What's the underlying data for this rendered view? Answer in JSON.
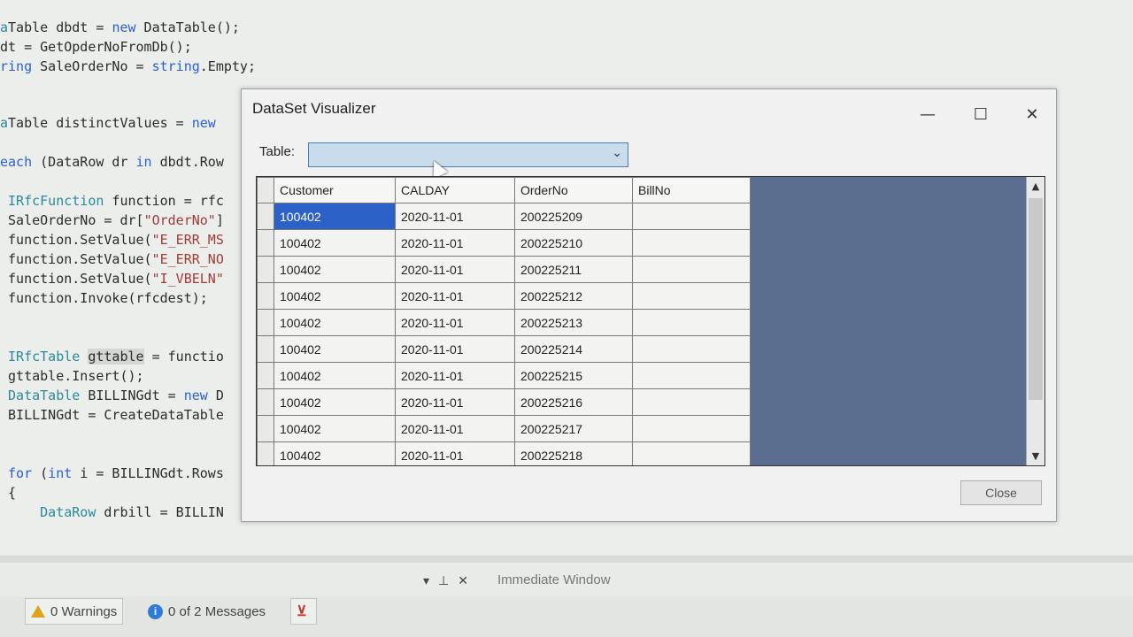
{
  "code": {
    "lines": [
      "aTable dbdt = new DataTable();",
      "dt = GetOpderNoFromDb();",
      "ring SaleOrderNo = string.Empty;",
      "aTable distinctValues = new",
      "each (DataRow dr in dbdt.Row",
      " IRfcFunction function = rfc",
      " SaleOrderNo = dr[\"OrderNo\"]",
      " function.SetValue(\"E_ERR_MS",
      " function.SetValue(\"E_ERR_NO",
      " function.SetValue(\"I_VBELN\"",
      " function.Invoke(rfcdest);",
      " IRfcTable gttable = functio",
      " gttable.Insert();",
      " DataTable BILLINGdt = new D",
      " BILLINGdt = CreateDataTable",
      " for (int i = BILLINGdt.Rows",
      " {",
      "     DataRow drbill = BILLIN"
    ]
  },
  "dialog": {
    "title": "DataSet Visualizer",
    "minimize": "—",
    "maximize": "☐",
    "close_x": "✕",
    "table_label": "Table:",
    "table_value": "",
    "close_button": "Close"
  },
  "grid": {
    "columns": [
      "Customer",
      "CALDAY",
      "OrderNo",
      "BillNo"
    ],
    "rows": [
      [
        "100402",
        "2020-11-01",
        "200225209",
        ""
      ],
      [
        "100402",
        "2020-11-01",
        "200225210",
        ""
      ],
      [
        "100402",
        "2020-11-01",
        "200225211",
        ""
      ],
      [
        "100402",
        "2020-11-01",
        "200225212",
        ""
      ],
      [
        "100402",
        "2020-11-01",
        "200225213",
        ""
      ],
      [
        "100402",
        "2020-11-01",
        "200225214",
        ""
      ],
      [
        "100402",
        "2020-11-01",
        "200225215",
        ""
      ],
      [
        "100402",
        "2020-11-01",
        "200225216",
        ""
      ],
      [
        "100402",
        "2020-11-01",
        "200225217",
        ""
      ],
      [
        "100402",
        "2020-11-01",
        "200225218",
        ""
      ]
    ]
  },
  "panel": {
    "immediate_window": "Immediate Window"
  },
  "status": {
    "warnings": "0 Warnings",
    "messages": "0 of 2 Messages"
  }
}
